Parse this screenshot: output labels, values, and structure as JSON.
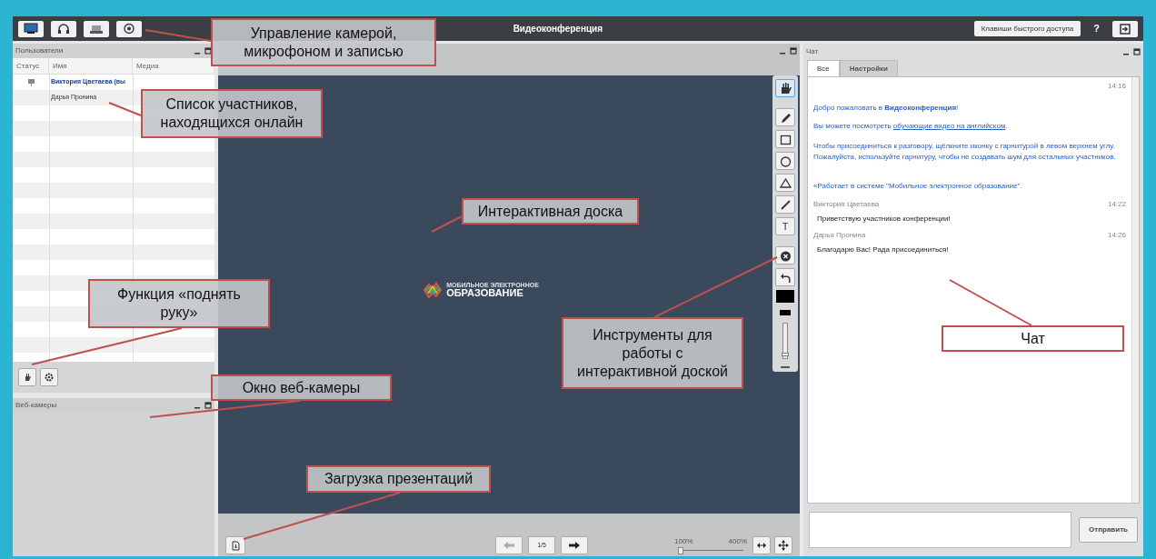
{
  "top_bar": {
    "media_buttons": [
      {
        "kind": "screen"
      },
      {
        "kind": "headset"
      },
      {
        "kind": "webcam"
      },
      {
        "kind": "record"
      }
    ],
    "title": "Видеоконференция",
    "shortcuts_button": "Клавиши быстрого доступа",
    "help_button": "?"
  },
  "users_panel": {
    "title": "Пользователи",
    "columns": [
      "Статус",
      "Имя",
      "Медиа"
    ],
    "rows": [
      {
        "name": "Виктория Цветаева (вы",
        "current": true,
        "presenter": true
      },
      {
        "name": "Дарья Пронина",
        "current": false,
        "presenter": false
      }
    ]
  },
  "webcam_panel": {
    "title": "Веб-камеры"
  },
  "presentation": {
    "logo_small": "МОБИЛЬНОЕ ЭЛЕКТРОННОЕ",
    "logo_big": "ОБРАЗОВАНИЕ",
    "page": "1/5",
    "zoom_min": "100%",
    "zoom_max": "400%",
    "zoom": {
      "level": 0
    },
    "tools": [
      {
        "kind": "hand",
        "selected": true
      },
      {
        "kind": "pencil",
        "selected": false
      },
      {
        "kind": "rectangle",
        "selected": false
      },
      {
        "kind": "ellipse",
        "selected": false
      },
      {
        "kind": "triangle",
        "selected": false
      },
      {
        "kind": "line",
        "selected": false
      },
      {
        "kind": "text",
        "label": "T",
        "selected": false
      },
      {
        "kind": "clear",
        "selected": false
      },
      {
        "kind": "undo",
        "selected": false
      },
      {
        "kind": "swatch",
        "selected": false
      },
      {
        "kind": "thickness",
        "selected": false
      },
      {
        "kind": "size_slider",
        "level": 0.1
      }
    ]
  },
  "chat": {
    "title": "Чат",
    "tabs": [
      {
        "label": "Все",
        "selected": true
      },
      {
        "label": "Настройки",
        "selected": false
      }
    ],
    "welcome_time": "14:16",
    "system_lines": [
      {
        "kind": "text",
        "text": "Добро пожаловать в **Видеоконференция**!"
      },
      {
        "kind": "link",
        "before": "Вы можете посмотреть ",
        "link": "обучающие видео на английском",
        "after": "."
      },
      {
        "kind": "text",
        "text": "Чтобы присоединиться к разговору, щёлкните иконку с гарнитурой в левом верхнем углу. Пожалуйста, используйте гарнитуру, чтобы не создавать шум для остальных участников."
      },
      {
        "kind": "text",
        "text": "«Работает в системе \"Мобильное электронное образование\"."
      }
    ],
    "messages": [
      {
        "author": "Виктория Цветаева",
        "time": "14:22",
        "text": "Приветствую участников конференции!"
      },
      {
        "author": "Дарья Пронина",
        "time": "14:26",
        "text": "Благодарю Вас! Рада присоединиться!"
      }
    ],
    "send_button": "Отправить"
  },
  "callouts": [
    "Управление камерой, микрофоном и записью",
    "Список участников, находящихся онлайн",
    "Интерактивная доска",
    "Функция «поднять руку»",
    "Окно веб-камеры",
    "Инструменты для работы с интерактивной доской",
    "Чат",
    "Загрузка презентаций"
  ]
}
